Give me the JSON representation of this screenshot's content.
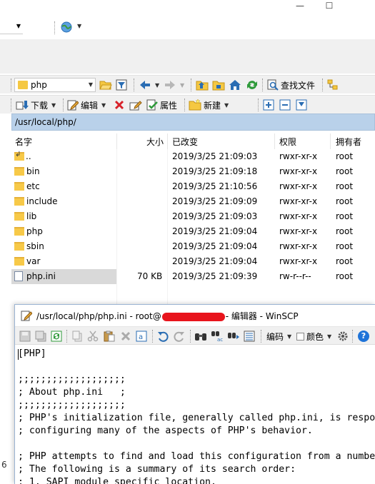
{
  "window_controls": {
    "minimize": "—",
    "maximize": "☐"
  },
  "path_combo": {
    "value": "php"
  },
  "toolbar2": {
    "download": "下载",
    "edit": "编辑",
    "properties": "属性",
    "new": "新建"
  },
  "toolbar1": {
    "find_files": "查找文件"
  },
  "current_path": "/usr/local/php/",
  "columns": [
    "名字",
    "大小",
    "已改变",
    "权限",
    "拥有者"
  ],
  "files": [
    {
      "name": "..",
      "size": "",
      "changed": "2019/3/25 21:09:03",
      "rights": "rwxr-xr-x",
      "owner": "root",
      "type": "up"
    },
    {
      "name": "bin",
      "size": "",
      "changed": "2019/3/25 21:09:18",
      "rights": "rwxr-xr-x",
      "owner": "root",
      "type": "folder"
    },
    {
      "name": "etc",
      "size": "",
      "changed": "2019/3/25 21:10:56",
      "rights": "rwxr-xr-x",
      "owner": "root",
      "type": "folder"
    },
    {
      "name": "include",
      "size": "",
      "changed": "2019/3/25 21:09:09",
      "rights": "rwxr-xr-x",
      "owner": "root",
      "type": "folder"
    },
    {
      "name": "lib",
      "size": "",
      "changed": "2019/3/25 21:09:03",
      "rights": "rwxr-xr-x",
      "owner": "root",
      "type": "folder"
    },
    {
      "name": "php",
      "size": "",
      "changed": "2019/3/25 21:09:04",
      "rights": "rwxr-xr-x",
      "owner": "root",
      "type": "folder"
    },
    {
      "name": "sbin",
      "size": "",
      "changed": "2019/3/25 21:09:04",
      "rights": "rwxr-xr-x",
      "owner": "root",
      "type": "folder"
    },
    {
      "name": "var",
      "size": "",
      "changed": "2019/3/25 21:09:04",
      "rights": "rwxr-xr-x",
      "owner": "root",
      "type": "folder"
    },
    {
      "name": "php.ini",
      "size": "70 KB",
      "changed": "2019/3/25 21:09:39",
      "rights": "rw-r--r--",
      "owner": "root",
      "type": "file"
    }
  ],
  "editor": {
    "title_prefix": "/usr/local/php/php.ini - root@",
    "title_suffix": "- 编辑器 - WinSCP",
    "toolbar": {
      "encoding": "编码",
      "color": "颜色",
      "help": "?"
    },
    "lines": [
      "[PHP]",
      "",
      ";;;;;;;;;;;;;;;;;;;",
      "; About php.ini   ;",
      ";;;;;;;;;;;;;;;;;;;",
      "; PHP's initialization file, generally called php.ini, is respo",
      "; configuring many of the aspects of PHP's behavior.",
      "",
      "; PHP attempts to find and load this configuration from a numbe",
      "; The following is a summary of its search order:",
      "; 1. SAPI module specific location."
    ]
  },
  "partial_left_text": "6"
}
